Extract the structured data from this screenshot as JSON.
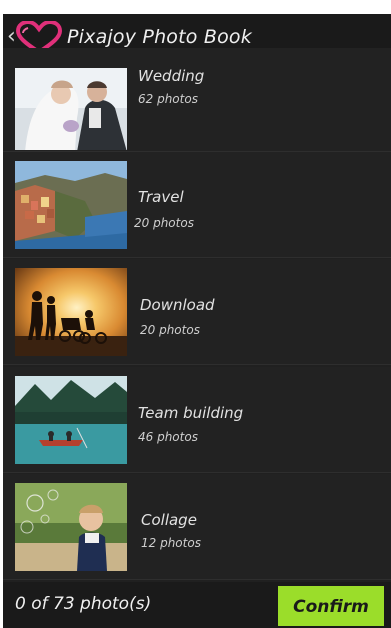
{
  "header": {
    "back_icon": "chevron-left-icon",
    "logo_icon": "heart-logo-icon",
    "title": "Pixajoy Photo Book"
  },
  "albums": [
    {
      "name": "Wedding",
      "count": "62 photos",
      "thumbnail": "wedding-photo"
    },
    {
      "name": "Travel",
      "count": "20 photos",
      "thumbnail": "travel-photo"
    },
    {
      "name": "Download",
      "count": "20 photos",
      "thumbnail": "sunset-family-photo"
    },
    {
      "name": "Team building",
      "count": "46 photos",
      "thumbnail": "lake-canoe-photo"
    },
    {
      "name": "Collage",
      "count": "12 photos",
      "thumbnail": "child-bubbles-photo"
    }
  ],
  "footer": {
    "selection_text": "0 of 73 photo(s)",
    "confirm_label": "Confirm"
  },
  "colors": {
    "background": "#202020",
    "bar": "#1a1a1a",
    "accent_pink": "#e0307a",
    "confirm_green": "#9bdd2a"
  }
}
